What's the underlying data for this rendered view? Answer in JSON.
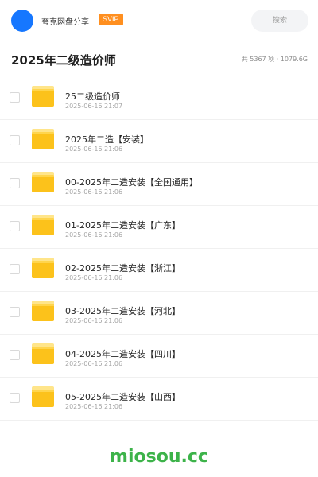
{
  "header": {
    "brand": "夸克网盘分享",
    "badge": "SVIP",
    "search_placeholder": "搜索",
    "avatar_color": "#1677ff"
  },
  "folder": {
    "title": "2025年二级造价师",
    "stats": "共 5367 项 · 1079.6G"
  },
  "items": [
    {
      "name": "25二级造价师",
      "date": "2025-06-16 21:07",
      "icon": "folder-icon"
    },
    {
      "name": "2025年二造【安装】",
      "date": "2025-06-16 21:06",
      "icon": "folder-icon"
    },
    {
      "name": "00-2025年二造安装【全国通用】",
      "date": "2025-06-16 21:06",
      "icon": "folder-icon"
    },
    {
      "name": "01-2025年二造安装【广东】",
      "date": "2025-06-16 21:06",
      "icon": "folder-icon"
    },
    {
      "name": "02-2025年二造安装【浙江】",
      "date": "2025-06-16 21:06",
      "icon": "folder-icon"
    },
    {
      "name": "03-2025年二造安装【河北】",
      "date": "2025-06-16 21:06",
      "icon": "folder-icon"
    },
    {
      "name": "04-2025年二造安装【四川】",
      "date": "2025-06-16 21:06",
      "icon": "folder-icon"
    },
    {
      "name": "05-2025年二造安装【山西】",
      "date": "2025-06-16 21:06",
      "icon": "folder-icon"
    }
  ],
  "footer": {
    "watermark": "miosou.cc",
    "watermark_color": "#3db34a"
  },
  "colors": {
    "badge": "#ff8f1f",
    "folder": "#fcc21b"
  }
}
